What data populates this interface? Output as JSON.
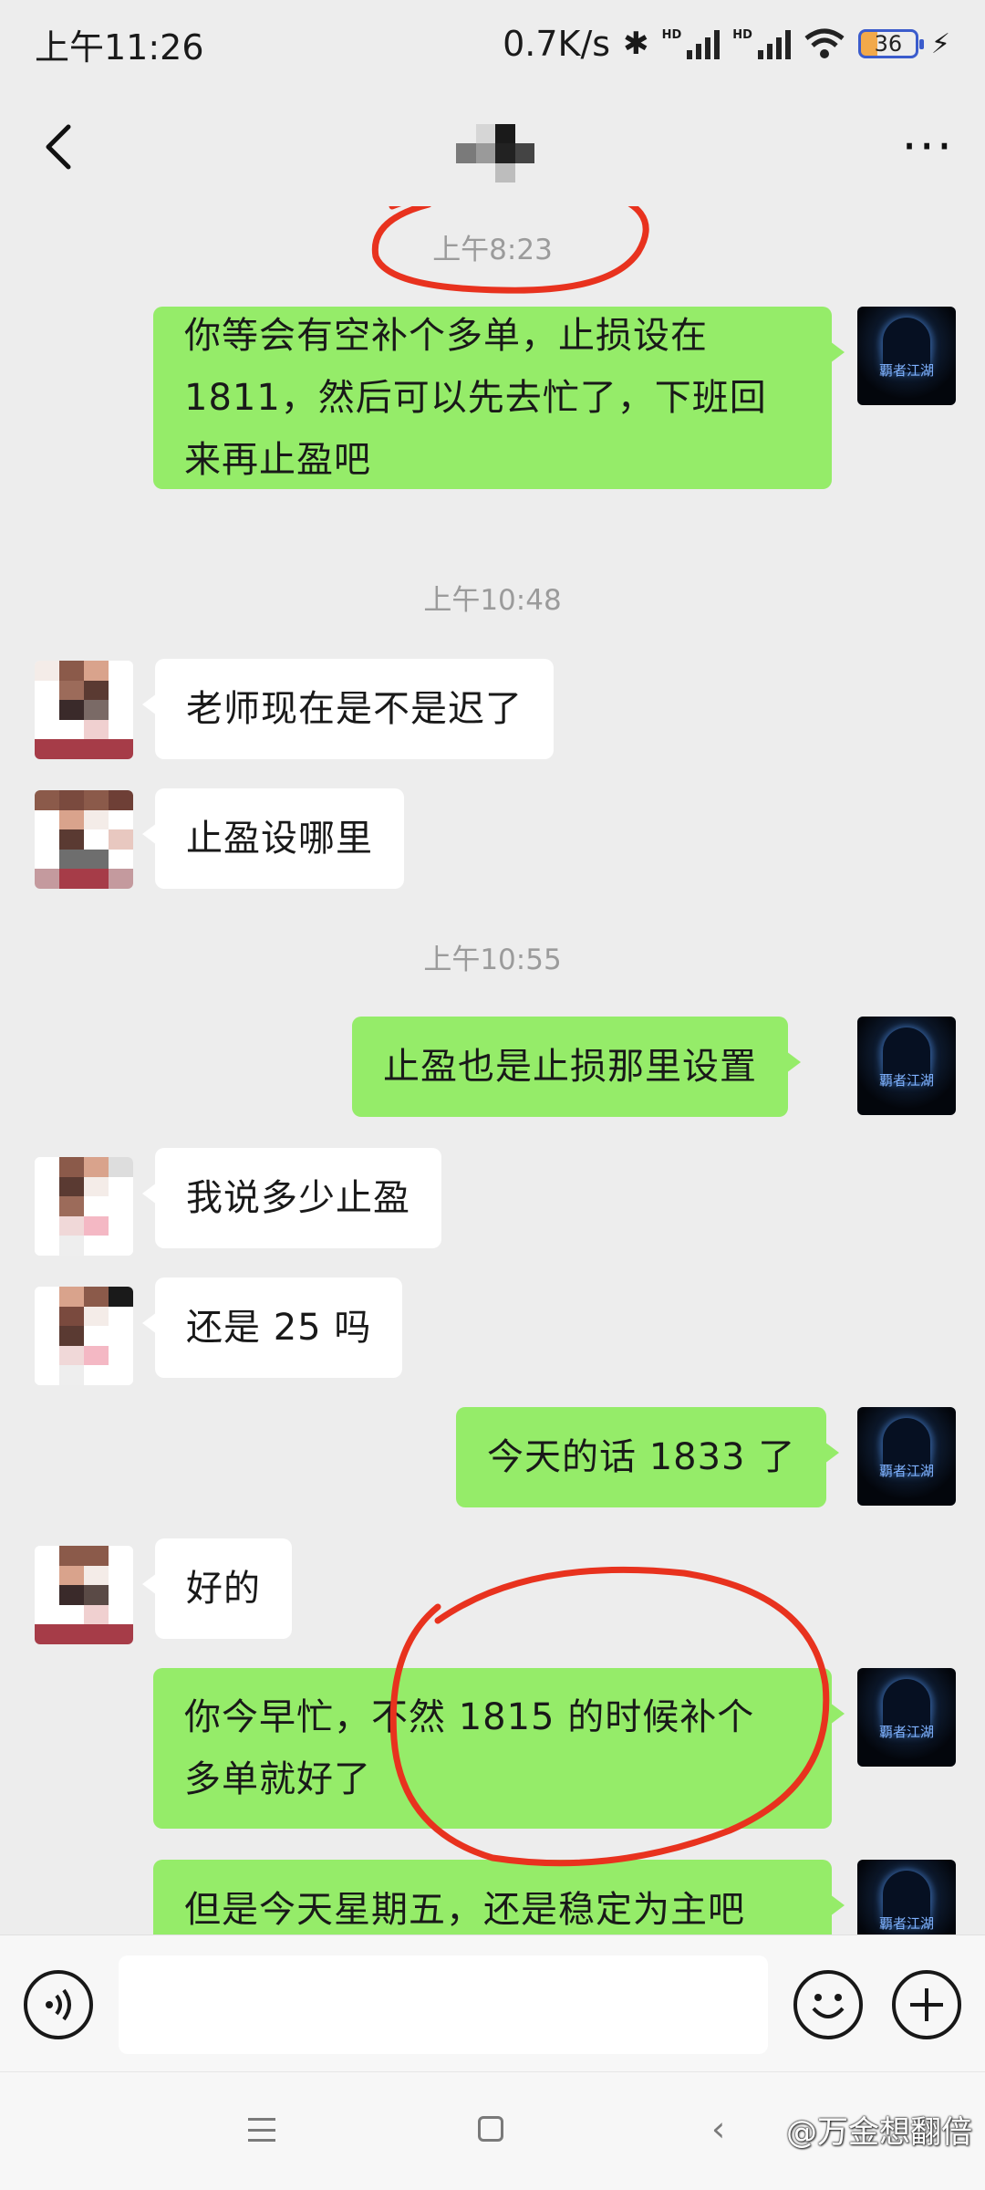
{
  "status_bar": {
    "time": "上午11:26",
    "net_speed": "0.7K/s",
    "sim1": "HD",
    "sim2": "HD",
    "battery": "36"
  },
  "header": {
    "back_icon": "chevron-left-icon",
    "more_label": "···"
  },
  "messages": [
    {
      "type": "time",
      "text": "上午8:23"
    },
    {
      "type": "msg",
      "side": "me",
      "lines": [
        "你等会有空补个多单，止损设在",
        "1811，然后可以先去忙了，下班回",
        "来再止盈吧"
      ]
    },
    {
      "type": "time",
      "text": "上午10:48"
    },
    {
      "type": "msg",
      "side": "other",
      "lines": [
        "老师现在是不是迟了"
      ]
    },
    {
      "type": "msg",
      "side": "other",
      "lines": [
        "止盈设哪里"
      ]
    },
    {
      "type": "time",
      "text": "上午10:55"
    },
    {
      "type": "msg",
      "side": "me",
      "lines": [
        "止盈也是止损那里设置"
      ]
    },
    {
      "type": "msg",
      "side": "other",
      "lines": [
        "我说多少止盈"
      ]
    },
    {
      "type": "msg",
      "side": "other",
      "lines": [
        "还是 25 吗"
      ]
    },
    {
      "type": "msg",
      "side": "me",
      "lines": [
        "今天的话 1833 了"
      ]
    },
    {
      "type": "msg",
      "side": "other",
      "lines": [
        "好的"
      ]
    },
    {
      "type": "msg",
      "side": "me",
      "lines": [
        "你今早忙，不然 1815 的时候补个",
        "多单就好了"
      ]
    },
    {
      "type": "msg",
      "side": "me",
      "lines": [
        "但是今天星期五，还是稳定为主吧"
      ]
    }
  ],
  "my_avatar_text": "覇者江湖",
  "input_bar": {
    "value": "",
    "voice_icon": "voice-icon",
    "emoji_icon": "emoji-icon",
    "plus_icon": "plus-icon"
  },
  "watermark": "@万金想翻倍",
  "colors": {
    "my_bubble": "#95ec69",
    "other_bubble": "#ffffff",
    "background": "#ededed",
    "annotation": "#e8321e"
  }
}
